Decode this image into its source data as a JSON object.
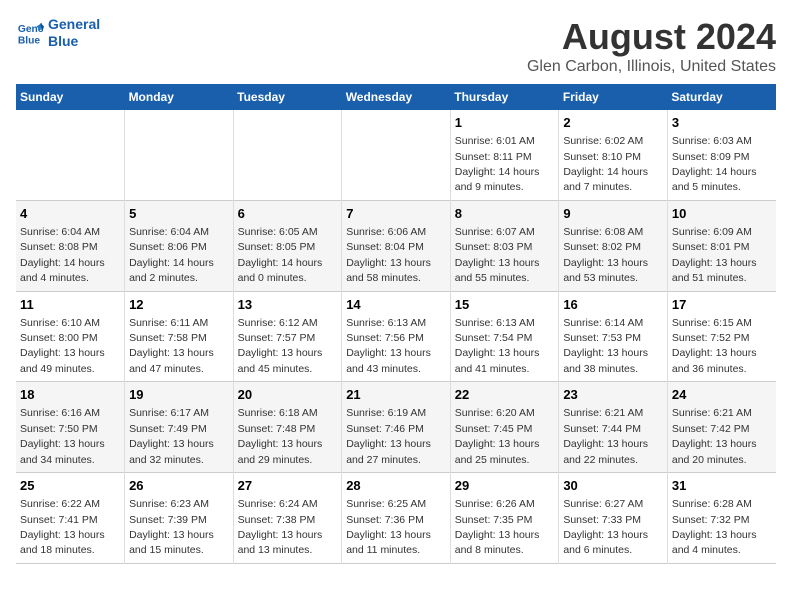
{
  "logo": {
    "line1": "General",
    "line2": "Blue"
  },
  "title": "August 2024",
  "subtitle": "Glen Carbon, Illinois, United States",
  "columns": [
    "Sunday",
    "Monday",
    "Tuesday",
    "Wednesday",
    "Thursday",
    "Friday",
    "Saturday"
  ],
  "weeks": [
    [
      {
        "day": "",
        "sunrise": "",
        "sunset": "",
        "daylight": ""
      },
      {
        "day": "",
        "sunrise": "",
        "sunset": "",
        "daylight": ""
      },
      {
        "day": "",
        "sunrise": "",
        "sunset": "",
        "daylight": ""
      },
      {
        "day": "",
        "sunrise": "",
        "sunset": "",
        "daylight": ""
      },
      {
        "day": "1",
        "sunrise": "Sunrise: 6:01 AM",
        "sunset": "Sunset: 8:11 PM",
        "daylight": "Daylight: 14 hours and 9 minutes."
      },
      {
        "day": "2",
        "sunrise": "Sunrise: 6:02 AM",
        "sunset": "Sunset: 8:10 PM",
        "daylight": "Daylight: 14 hours and 7 minutes."
      },
      {
        "day": "3",
        "sunrise": "Sunrise: 6:03 AM",
        "sunset": "Sunset: 8:09 PM",
        "daylight": "Daylight: 14 hours and 5 minutes."
      }
    ],
    [
      {
        "day": "4",
        "sunrise": "Sunrise: 6:04 AM",
        "sunset": "Sunset: 8:08 PM",
        "daylight": "Daylight: 14 hours and 4 minutes."
      },
      {
        "day": "5",
        "sunrise": "Sunrise: 6:04 AM",
        "sunset": "Sunset: 8:06 PM",
        "daylight": "Daylight: 14 hours and 2 minutes."
      },
      {
        "day": "6",
        "sunrise": "Sunrise: 6:05 AM",
        "sunset": "Sunset: 8:05 PM",
        "daylight": "Daylight: 14 hours and 0 minutes."
      },
      {
        "day": "7",
        "sunrise": "Sunrise: 6:06 AM",
        "sunset": "Sunset: 8:04 PM",
        "daylight": "Daylight: 13 hours and 58 minutes."
      },
      {
        "day": "8",
        "sunrise": "Sunrise: 6:07 AM",
        "sunset": "Sunset: 8:03 PM",
        "daylight": "Daylight: 13 hours and 55 minutes."
      },
      {
        "day": "9",
        "sunrise": "Sunrise: 6:08 AM",
        "sunset": "Sunset: 8:02 PM",
        "daylight": "Daylight: 13 hours and 53 minutes."
      },
      {
        "day": "10",
        "sunrise": "Sunrise: 6:09 AM",
        "sunset": "Sunset: 8:01 PM",
        "daylight": "Daylight: 13 hours and 51 minutes."
      }
    ],
    [
      {
        "day": "11",
        "sunrise": "Sunrise: 6:10 AM",
        "sunset": "Sunset: 8:00 PM",
        "daylight": "Daylight: 13 hours and 49 minutes."
      },
      {
        "day": "12",
        "sunrise": "Sunrise: 6:11 AM",
        "sunset": "Sunset: 7:58 PM",
        "daylight": "Daylight: 13 hours and 47 minutes."
      },
      {
        "day": "13",
        "sunrise": "Sunrise: 6:12 AM",
        "sunset": "Sunset: 7:57 PM",
        "daylight": "Daylight: 13 hours and 45 minutes."
      },
      {
        "day": "14",
        "sunrise": "Sunrise: 6:13 AM",
        "sunset": "Sunset: 7:56 PM",
        "daylight": "Daylight: 13 hours and 43 minutes."
      },
      {
        "day": "15",
        "sunrise": "Sunrise: 6:13 AM",
        "sunset": "Sunset: 7:54 PM",
        "daylight": "Daylight: 13 hours and 41 minutes."
      },
      {
        "day": "16",
        "sunrise": "Sunrise: 6:14 AM",
        "sunset": "Sunset: 7:53 PM",
        "daylight": "Daylight: 13 hours and 38 minutes."
      },
      {
        "day": "17",
        "sunrise": "Sunrise: 6:15 AM",
        "sunset": "Sunset: 7:52 PM",
        "daylight": "Daylight: 13 hours and 36 minutes."
      }
    ],
    [
      {
        "day": "18",
        "sunrise": "Sunrise: 6:16 AM",
        "sunset": "Sunset: 7:50 PM",
        "daylight": "Daylight: 13 hours and 34 minutes."
      },
      {
        "day": "19",
        "sunrise": "Sunrise: 6:17 AM",
        "sunset": "Sunset: 7:49 PM",
        "daylight": "Daylight: 13 hours and 32 minutes."
      },
      {
        "day": "20",
        "sunrise": "Sunrise: 6:18 AM",
        "sunset": "Sunset: 7:48 PM",
        "daylight": "Daylight: 13 hours and 29 minutes."
      },
      {
        "day": "21",
        "sunrise": "Sunrise: 6:19 AM",
        "sunset": "Sunset: 7:46 PM",
        "daylight": "Daylight: 13 hours and 27 minutes."
      },
      {
        "day": "22",
        "sunrise": "Sunrise: 6:20 AM",
        "sunset": "Sunset: 7:45 PM",
        "daylight": "Daylight: 13 hours and 25 minutes."
      },
      {
        "day": "23",
        "sunrise": "Sunrise: 6:21 AM",
        "sunset": "Sunset: 7:44 PM",
        "daylight": "Daylight: 13 hours and 22 minutes."
      },
      {
        "day": "24",
        "sunrise": "Sunrise: 6:21 AM",
        "sunset": "Sunset: 7:42 PM",
        "daylight": "Daylight: 13 hours and 20 minutes."
      }
    ],
    [
      {
        "day": "25",
        "sunrise": "Sunrise: 6:22 AM",
        "sunset": "Sunset: 7:41 PM",
        "daylight": "Daylight: 13 hours and 18 minutes."
      },
      {
        "day": "26",
        "sunrise": "Sunrise: 6:23 AM",
        "sunset": "Sunset: 7:39 PM",
        "daylight": "Daylight: 13 hours and 15 minutes."
      },
      {
        "day": "27",
        "sunrise": "Sunrise: 6:24 AM",
        "sunset": "Sunset: 7:38 PM",
        "daylight": "Daylight: 13 hours and 13 minutes."
      },
      {
        "day": "28",
        "sunrise": "Sunrise: 6:25 AM",
        "sunset": "Sunset: 7:36 PM",
        "daylight": "Daylight: 13 hours and 11 minutes."
      },
      {
        "day": "29",
        "sunrise": "Sunrise: 6:26 AM",
        "sunset": "Sunset: 7:35 PM",
        "daylight": "Daylight: 13 hours and 8 minutes."
      },
      {
        "day": "30",
        "sunrise": "Sunrise: 6:27 AM",
        "sunset": "Sunset: 7:33 PM",
        "daylight": "Daylight: 13 hours and 6 minutes."
      },
      {
        "day": "31",
        "sunrise": "Sunrise: 6:28 AM",
        "sunset": "Sunset: 7:32 PM",
        "daylight": "Daylight: 13 hours and 4 minutes."
      }
    ]
  ]
}
